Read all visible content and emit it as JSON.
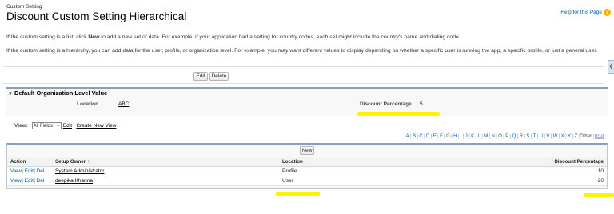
{
  "header": {
    "breadcrumb": "Custom Setting",
    "title": "Discount Custom Setting Hierarchical",
    "help_label": "Help for this Page",
    "help_icon": "help-icon"
  },
  "description": {
    "list_text_before": "If the custom setting is a list, click ",
    "list_text_bold": "New",
    "list_text_after": " to add a new set of data. For example, if your application had a setting for country codes, each set might include the country's name and dialing code.",
    "hierarchy_text": "If the custom setting is a hierarchy, you can add data for the user, profile, or organization level. For example, you may want different values to display depending on whether a specific user is running the app, a specific profile, or just a general user."
  },
  "toolbar": {
    "edit_label": "Edit",
    "delete_label": "Delete"
  },
  "side_tab_icon": "collapse-tab-icon",
  "default_section": {
    "title": "Default Organization Level Value",
    "location_label": "Location",
    "location_value": "ABC",
    "discount_label": "Discount Percentage",
    "discount_value": "5"
  },
  "view": {
    "label": "View:",
    "selected": "All Fields",
    "edit_link": "Edit",
    "create_link": "Create New View"
  },
  "alpha_filter": {
    "letters": [
      "A",
      "B",
      "C",
      "D",
      "E",
      "F",
      "G",
      "H",
      "I",
      "J",
      "K",
      "L",
      "M",
      "N",
      "O",
      "P",
      "Q",
      "R",
      "S",
      "T",
      "U",
      "V",
      "W",
      "X",
      "Y",
      "Z"
    ],
    "other": "Other",
    "all": "All"
  },
  "list": {
    "new_label": "New",
    "columns": {
      "action": "Action",
      "setup_owner": "Setup Owner",
      "location": "Location",
      "discount": "Discount Percentage"
    },
    "action_links": [
      "View",
      "Edit",
      "Del"
    ],
    "rows": [
      {
        "owner": "System Administrator",
        "location": "Profile",
        "discount": "10"
      },
      {
        "owner": "deepika Khanna",
        "location": "User",
        "discount": "20"
      }
    ]
  },
  "colors": {
    "highlight": "#fff200",
    "link": "#015ba7",
    "section_border": "#8e9dbe"
  }
}
